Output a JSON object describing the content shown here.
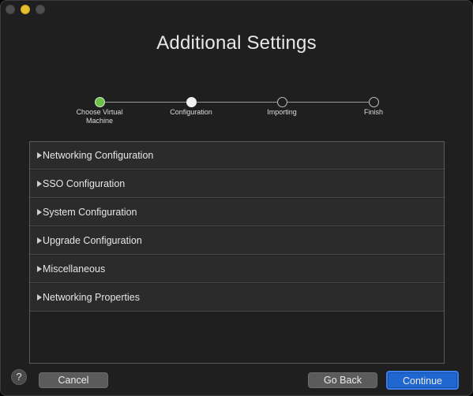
{
  "window": {
    "title": "Additional Settings"
  },
  "stepper": {
    "steps": [
      {
        "label": "Choose Virtual Machine",
        "state": "done"
      },
      {
        "label": "Configuration",
        "state": "current"
      },
      {
        "label": "Importing",
        "state": "todo"
      },
      {
        "label": "Finish",
        "state": "todo"
      }
    ]
  },
  "sections": [
    {
      "label": "Networking Configuration"
    },
    {
      "label": "SSO Configuration"
    },
    {
      "label": "System Configuration"
    },
    {
      "label": "Upgrade Configuration"
    },
    {
      "label": "Miscellaneous"
    },
    {
      "label": "Networking Properties"
    }
  ],
  "footer": {
    "help_label": "?",
    "cancel_label": "Cancel",
    "go_back_label": "Go Back",
    "continue_label": "Continue"
  },
  "colors": {
    "step_done": "#6cc04a",
    "primary_button": "#1f66d1",
    "window_bg": "#1f1f1f"
  }
}
